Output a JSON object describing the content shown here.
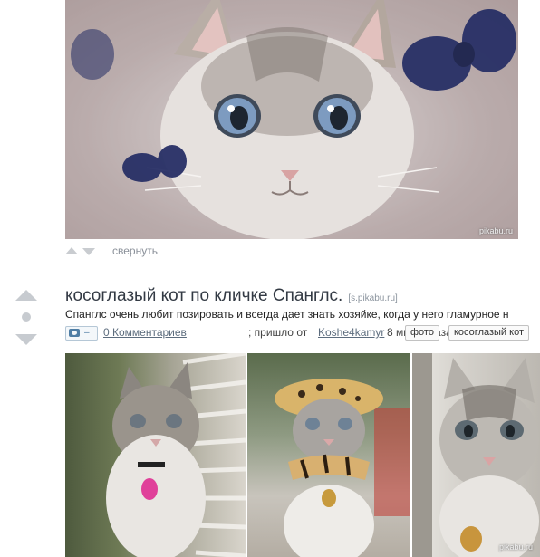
{
  "post1": {
    "watermark": "pikabu.ru",
    "collapse_label": "свернуть"
  },
  "post2": {
    "title": "косоглазый кот по кличке Спанглс.",
    "source": "[s.pikabu.ru]",
    "description": "Спанглс очень любит позировать и всегда дает знать хозяйке, когда у него гламурное н",
    "badge_count": "–",
    "comments_label": "0 Комментариев",
    "posted_by_text": "; пришло от",
    "author": "Koshe4kamyr",
    "time_ago": "8 минут назад",
    "tags": [
      "фото",
      "косоглазый кот"
    ],
    "watermark": "pikabu.ru"
  },
  "colors": {
    "vote_arrow": "#c7cbd0",
    "link": "#5d6d7e",
    "title": "#333a44",
    "badge_icon": "#4f7ea5"
  },
  "icons": [
    "upvote-arrow-icon",
    "downvote-arrow-icon",
    "rating-dot-icon",
    "camera-icon"
  ]
}
